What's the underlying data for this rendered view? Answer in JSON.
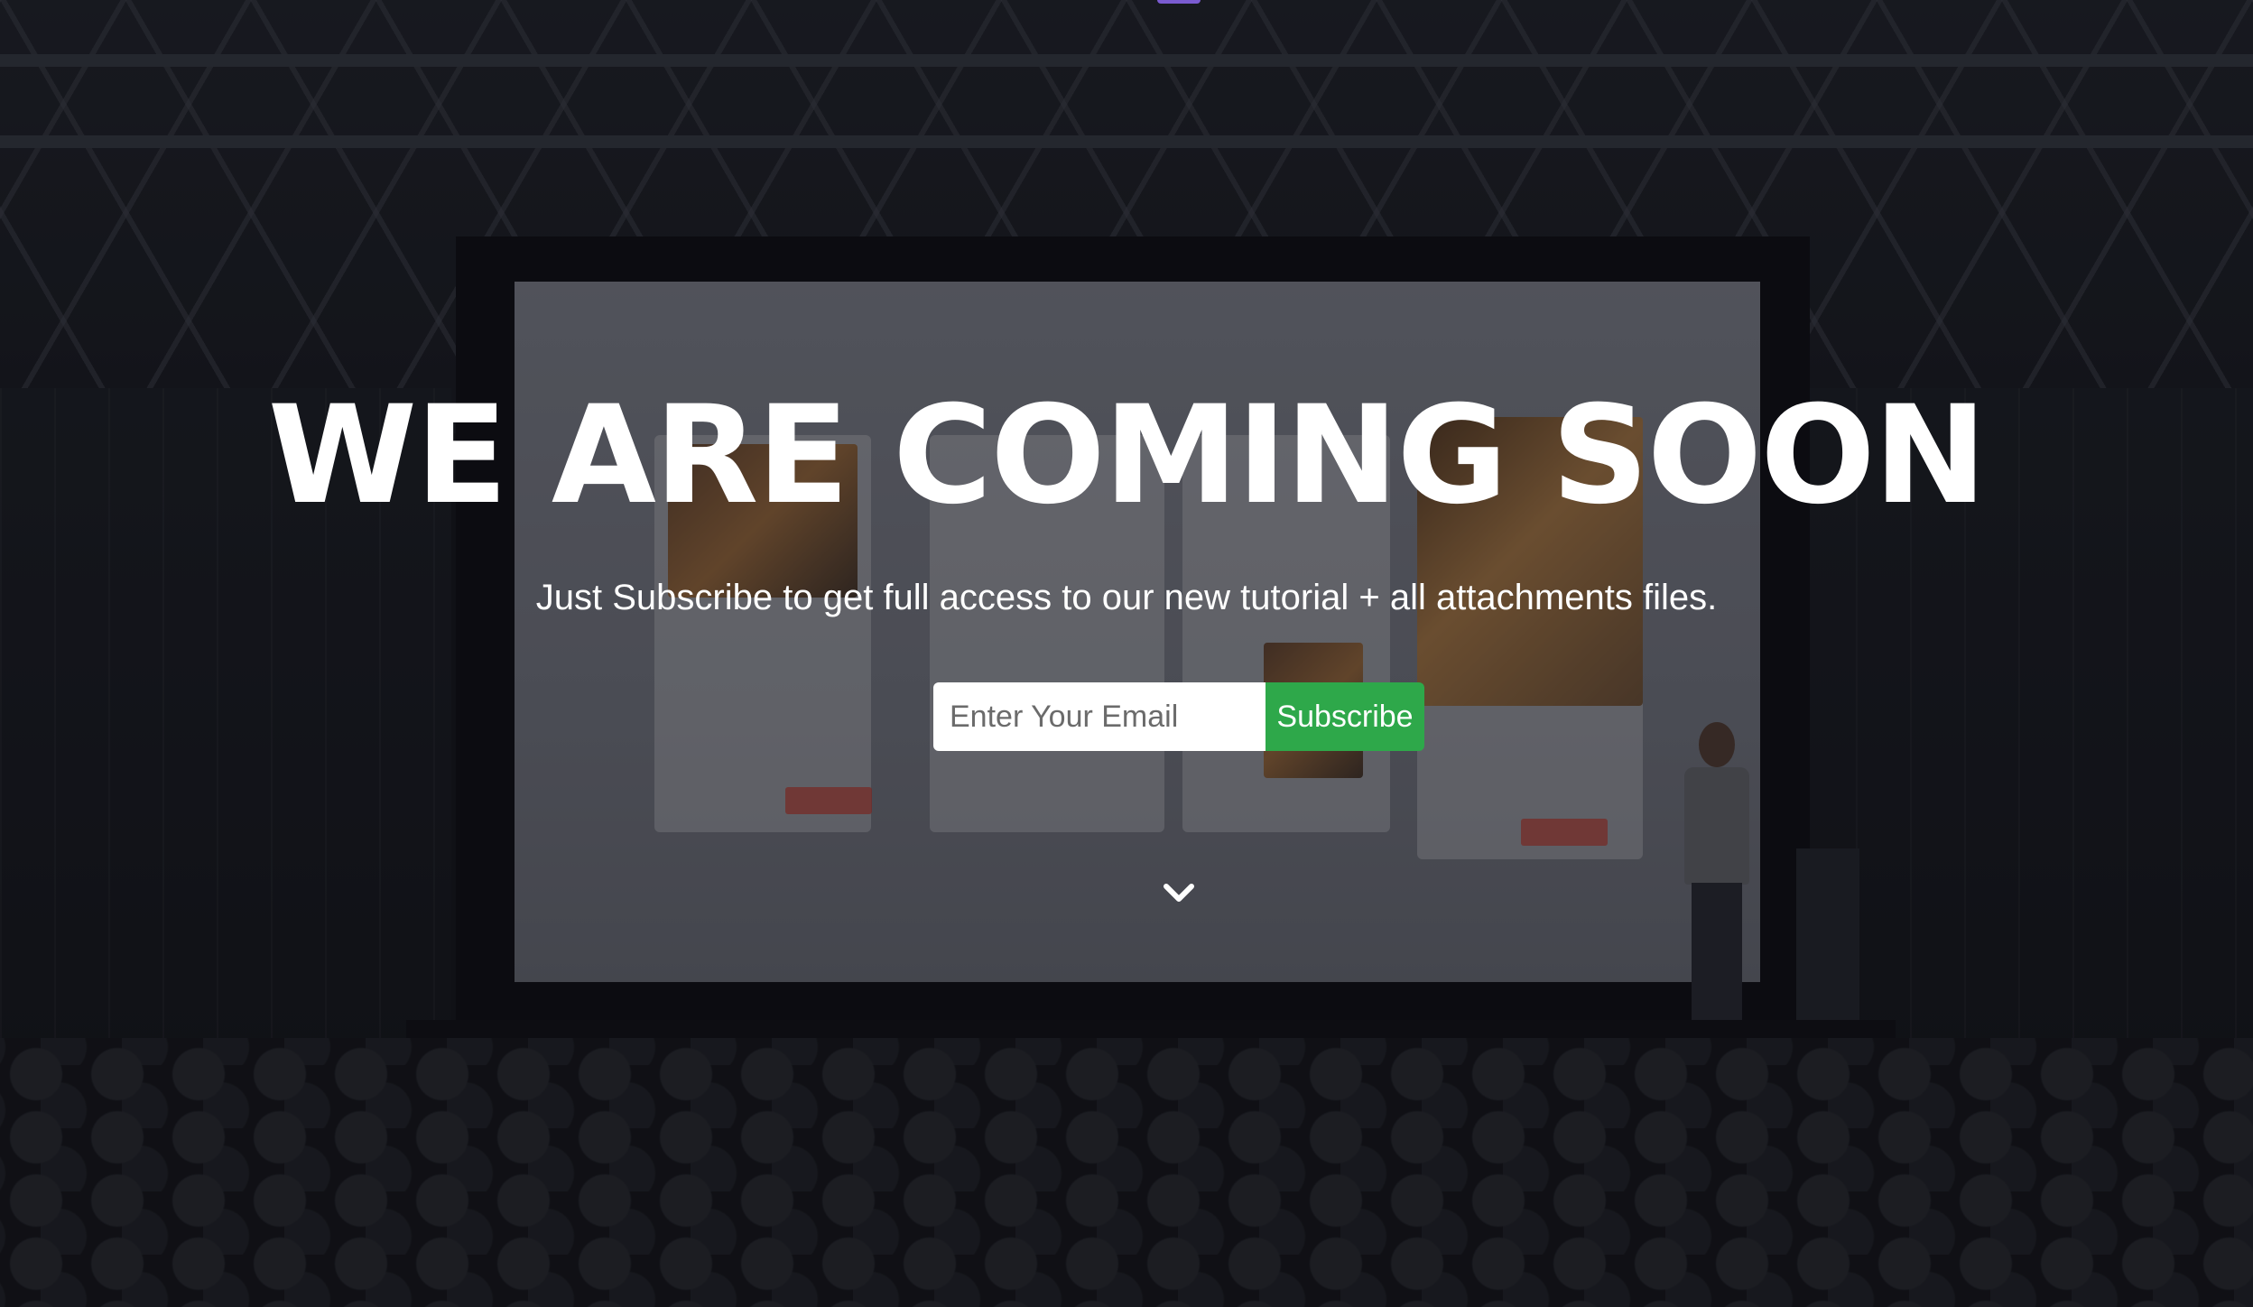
{
  "hero": {
    "title": "WE ARE COMING SOON",
    "subtitle": "Just Subscribe to get full access to our new tutorial + all attachments files."
  },
  "signup": {
    "email_placeholder": "Enter Your Email",
    "email_value": "",
    "subscribe_label": "Subscribe"
  },
  "icons": {
    "scroll": "chevron-down-icon"
  },
  "colors": {
    "subscribe_button": "#2ea84a",
    "text": "#ffffff",
    "overlay": "#0a0c12"
  }
}
